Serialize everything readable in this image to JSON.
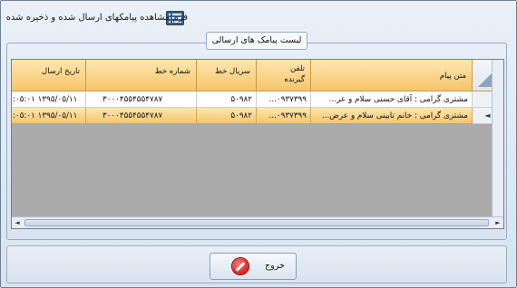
{
  "window": {
    "title": "فرم مشاهده پیامکهای ارسال شده و ذخیره شده"
  },
  "group": {
    "label": "لیست پیامک های ارسالی"
  },
  "grid": {
    "columns": [
      {
        "key": "date",
        "label": "تاریخ ارسال"
      },
      {
        "key": "line_number",
        "label": "شماره خط"
      },
      {
        "key": "line_serial",
        "label": "سریال خط"
      },
      {
        "key": "recipient",
        "label": "تلفن\nگیرنده"
      },
      {
        "key": "message",
        "label": "متن پیام"
      }
    ],
    "rows": [
      {
        "date": "۱۳۹۵/۰۵/۱۱ ۰۵:۰۱:",
        "line_number": "۳۰۰۰۴۵۵۴۵۵۴۷۸۷",
        "line_serial": "۵۰۹۸۲",
        "recipient": "۰۹۳۷۳۹۹...",
        "message": "مشتری گرامی : آقای حسنی سلام و عر...",
        "selected": false
      },
      {
        "date": "۱۳۹۵/۰۵/۱۱ ۰۵:۰۱:",
        "line_number": "۳۰۰۰۴۵۵۴۵۵۴۷۸۷",
        "line_serial": "۵۰۹۸۲",
        "recipient": "۰۹۳۷۳۹۹...",
        "message": "مشتری گرامی : خانم تابینی سلام و عرض...",
        "selected": true
      }
    ],
    "row_indicator": "◄"
  },
  "footer": {
    "exit_label": "خروج"
  },
  "icons": {
    "title": "list-icon",
    "exit": "stop-icon"
  }
}
